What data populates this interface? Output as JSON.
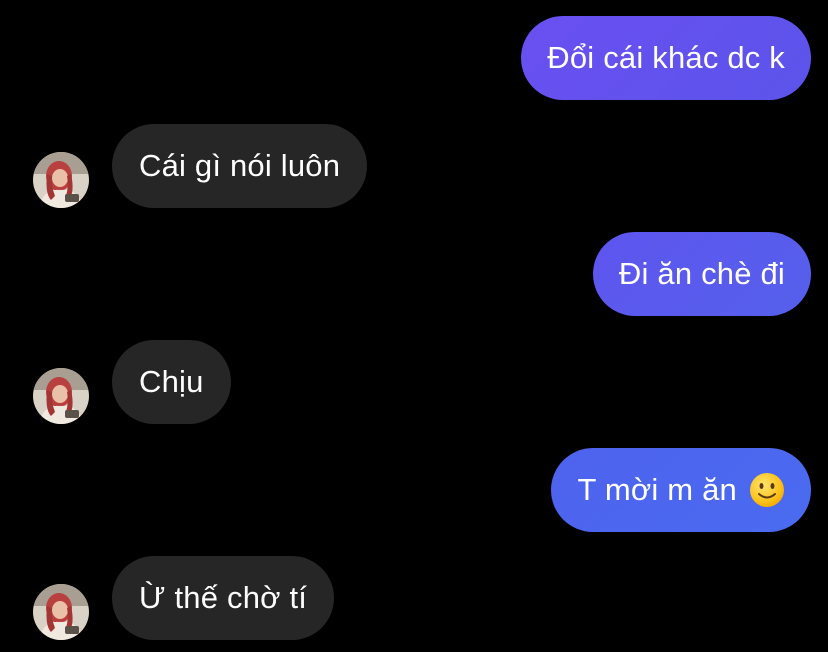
{
  "conversation": {
    "messages": [
      {
        "sender": "me",
        "text": "Đổi cái khác dc k"
      },
      {
        "sender": "other",
        "text": "Cái gì nói luôn"
      },
      {
        "sender": "me",
        "text": "Đi ăn chè đi"
      },
      {
        "sender": "other",
        "text": "Chịu"
      },
      {
        "sender": "me",
        "text": "T mời m ăn",
        "emoji": "slightly-smiling-face-icon"
      },
      {
        "sender": "other",
        "text": "Ừ thế chờ tí"
      }
    ]
  },
  "colors": {
    "sent_bubble_top": "#6a4ff2",
    "sent_bubble_bottom": "#4a6bf0",
    "received_bubble": "#262626",
    "background": "#000000",
    "text": "#ffffff"
  }
}
